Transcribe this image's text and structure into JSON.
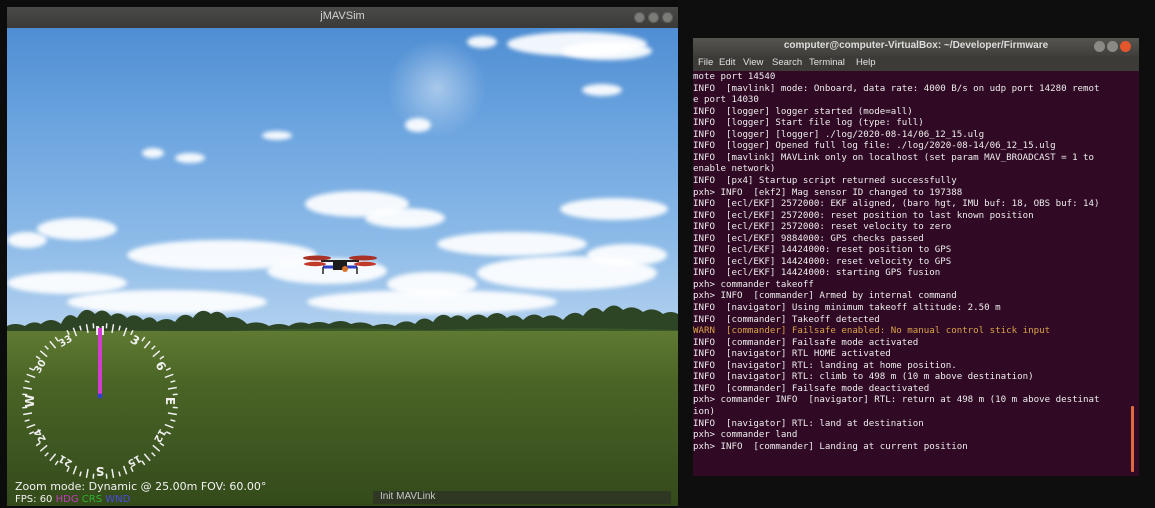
{
  "jmavsim": {
    "title": "jMAVSim",
    "hud": {
      "zoom_line": "Zoom mode: Dynamic @ 25.00m   FOV: 60.00°",
      "fps_label": "FPS:",
      "fps_value": "60",
      "hdg_label": "HDG",
      "crs_label": "CRS",
      "wind_label": "WND",
      "hdg_color": "#c23bbf",
      "crs_color": "#2fb52f",
      "wind_color": "#4a4ae0"
    },
    "compass": {
      "labels": [
        "N",
        "3",
        "6",
        "E",
        "12",
        "15",
        "S",
        "21",
        "24",
        "W",
        "30",
        "33"
      ],
      "heading_line_color": "#d43bd0"
    },
    "status": "Init MAVLink"
  },
  "terminal": {
    "title": "computer@computer-VirtualBox: ~/Developer/Firmware",
    "menu": [
      "File",
      "Edit",
      "View",
      "Search",
      "Terminal",
      "Help"
    ],
    "lines": [
      {
        "text": "mote port 14540",
        "warn": false
      },
      {
        "text": "INFO  [mavlink] mode: Onboard, data rate: 4000 B/s on udp port 14280 remot",
        "warn": false
      },
      {
        "text": "e port 14030",
        "warn": false
      },
      {
        "text": "INFO  [logger] logger started (mode=all)",
        "warn": false
      },
      {
        "text": "INFO  [logger] Start file log (type: full)",
        "warn": false
      },
      {
        "text": "INFO  [logger] [logger] ./log/2020-08-14/06_12_15.ulg",
        "warn": false
      },
      {
        "text": "INFO  [logger] Opened full log file: ./log/2020-08-14/06_12_15.ulg",
        "warn": false
      },
      {
        "text": "INFO  [mavlink] MAVLink only on localhost (set param MAV_BROADCAST = 1 to",
        "warn": false
      },
      {
        "text": "enable network)",
        "warn": false
      },
      {
        "text": "INFO  [px4] Startup script returned successfully",
        "warn": false
      },
      {
        "text": "pxh> INFO  [ekf2] Mag sensor ID changed to 197388",
        "warn": false
      },
      {
        "text": "INFO  [ecl/EKF] 2572000: EKF aligned, (baro hgt, IMU buf: 18, OBS buf: 14)",
        "warn": false
      },
      {
        "text": "INFO  [ecl/EKF] 2572000: reset position to last known position",
        "warn": false
      },
      {
        "text": "INFO  [ecl/EKF] 2572000: reset velocity to zero",
        "warn": false
      },
      {
        "text": "INFO  [ecl/EKF] 9884000: GPS checks passed",
        "warn": false
      },
      {
        "text": "INFO  [ecl/EKF] 14424000: reset position to GPS",
        "warn": false
      },
      {
        "text": "INFO  [ecl/EKF] 14424000: reset velocity to GPS",
        "warn": false
      },
      {
        "text": "INFO  [ecl/EKF] 14424000: starting GPS fusion",
        "warn": false
      },
      {
        "text": "pxh> commander takeoff",
        "warn": false
      },
      {
        "text": "pxh> INFO  [commander] Armed by internal command",
        "warn": false
      },
      {
        "text": "INFO  [navigator] Using minimum takeoff altitude: 2.50 m",
        "warn": false
      },
      {
        "text": "INFO  [commander] Takeoff detected",
        "warn": false
      },
      {
        "text": "WARN  [commander] Failsafe enabled: No manual control stick input",
        "warn": true
      },
      {
        "text": "INFO  [commander] Failsafe mode activated",
        "warn": false
      },
      {
        "text": "INFO  [navigator] RTL HOME activated",
        "warn": false
      },
      {
        "text": "INFO  [navigator] RTL: landing at home position.",
        "warn": false
      },
      {
        "text": "INFO  [navigator] RTL: climb to 498 m (10 m above destination)",
        "warn": false
      },
      {
        "text": "INFO  [commander] Failsafe mode deactivated",
        "warn": false
      },
      {
        "text": "pxh> commander INFO  [navigator] RTL: return at 498 m (10 m above destinat",
        "warn": false
      },
      {
        "text": "ion)",
        "warn": false
      },
      {
        "text": "INFO  [navigator] RTL: land at destination",
        "warn": false
      },
      {
        "text": "pxh> commander land",
        "warn": false
      },
      {
        "text": "pxh> INFO  [commander] Landing at current position",
        "warn": false
      }
    ]
  }
}
